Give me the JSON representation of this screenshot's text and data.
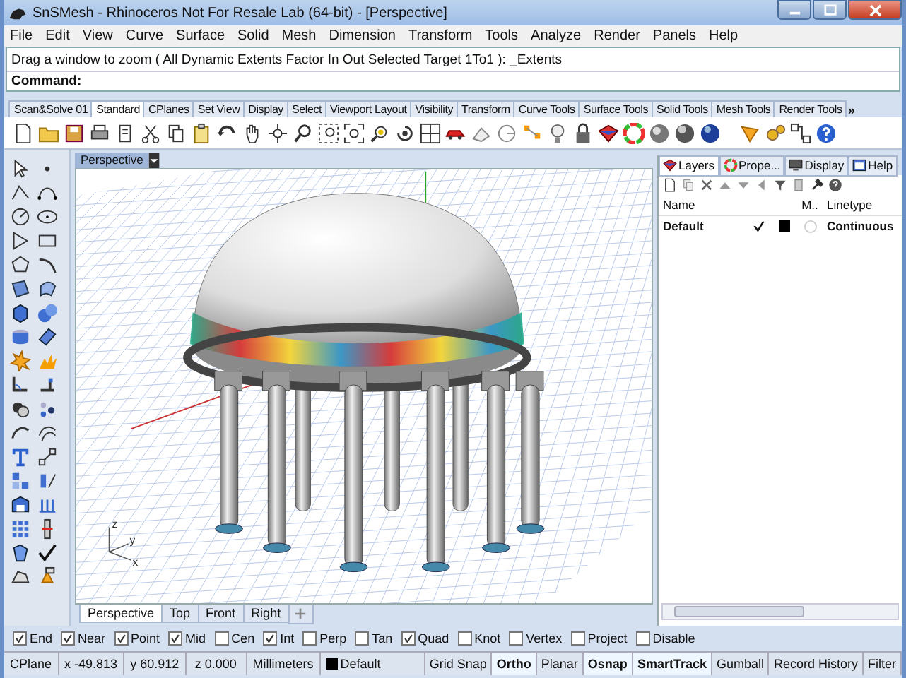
{
  "window": {
    "title": "SnSMesh - Rhinoceros Not For Resale Lab (64-bit) - [Perspective]"
  },
  "menu": [
    "File",
    "Edit",
    "View",
    "Curve",
    "Surface",
    "Solid",
    "Mesh",
    "Dimension",
    "Transform",
    "Tools",
    "Analyze",
    "Render",
    "Panels",
    "Help"
  ],
  "command": {
    "history": "Drag a window to zoom ( All  Dynamic  Extents  Factor  In  Out  Selected  Target  1To1 ): _Extents",
    "prompt": "Command:"
  },
  "toolbar_tabs": [
    {
      "label": "Scan&Solve 01",
      "selected": false
    },
    {
      "label": "Standard",
      "selected": true
    },
    {
      "label": "CPlanes",
      "selected": false
    },
    {
      "label": "Set View",
      "selected": false
    },
    {
      "label": "Display",
      "selected": false
    },
    {
      "label": "Select",
      "selected": false
    },
    {
      "label": "Viewport Layout",
      "selected": false
    },
    {
      "label": "Visibility",
      "selected": false
    },
    {
      "label": "Transform",
      "selected": false
    },
    {
      "label": "Curve Tools",
      "selected": false
    },
    {
      "label": "Surface Tools",
      "selected": false
    },
    {
      "label": "Solid Tools",
      "selected": false
    },
    {
      "label": "Mesh Tools",
      "selected": false
    },
    {
      "label": "Render Tools",
      "selected": false
    }
  ],
  "toolbar_more": "»",
  "viewport": {
    "title": "Perspective",
    "axis_labels": [
      "z",
      "y",
      "x"
    ]
  },
  "viewport_tabs": [
    {
      "label": "Perspective",
      "selected": true
    },
    {
      "label": "Top",
      "selected": false
    },
    {
      "label": "Front",
      "selected": false
    },
    {
      "label": "Right",
      "selected": false
    }
  ],
  "panel": {
    "tabs": [
      {
        "label": "Layers",
        "selected": true
      },
      {
        "label": "Prope...",
        "selected": false
      },
      {
        "label": "Display",
        "selected": false
      },
      {
        "label": "Help",
        "selected": false
      }
    ],
    "columns": [
      "Name",
      "M..",
      "Linetype"
    ],
    "rows": [
      {
        "name": "Default",
        "current": true,
        "color": "#000000",
        "linetype": "Continuous"
      }
    ]
  },
  "osnaps": [
    {
      "label": "End",
      "checked": true
    },
    {
      "label": "Near",
      "checked": true
    },
    {
      "label": "Point",
      "checked": true
    },
    {
      "label": "Mid",
      "checked": true
    },
    {
      "label": "Cen",
      "checked": false
    },
    {
      "label": "Int",
      "checked": true
    },
    {
      "label": "Perp",
      "checked": false
    },
    {
      "label": "Tan",
      "checked": false
    },
    {
      "label": "Quad",
      "checked": true
    },
    {
      "label": "Knot",
      "checked": false
    },
    {
      "label": "Vertex",
      "checked": false
    },
    {
      "label": "Project",
      "checked": false
    },
    {
      "label": "Disable",
      "checked": false
    }
  ],
  "status_bar": {
    "cplane": "CPlane",
    "x": "x -49.813",
    "y": "y 60.912",
    "z": "z 0.000",
    "units": "Millimeters",
    "layer": {
      "name": "Default",
      "color": "#000000"
    },
    "toggles": [
      {
        "label": "Grid Snap",
        "on": false
      },
      {
        "label": "Ortho",
        "on": true
      },
      {
        "label": "Planar",
        "on": false
      },
      {
        "label": "Osnap",
        "on": true
      },
      {
        "label": "SmartTrack",
        "on": true
      },
      {
        "label": "Gumball",
        "on": false
      },
      {
        "label": "Record History",
        "on": false
      },
      {
        "label": "Filter",
        "on": false
      }
    ]
  }
}
